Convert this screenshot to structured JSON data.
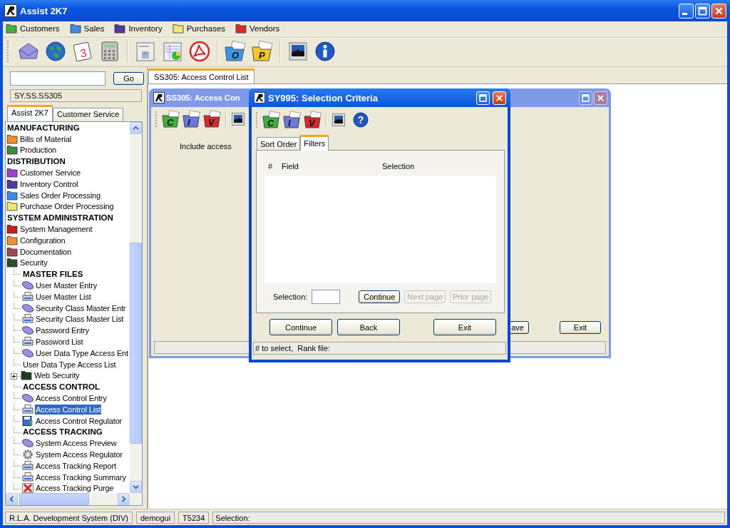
{
  "window": {
    "title": "Assist 2K7"
  },
  "menu": [
    {
      "label": "Customers",
      "color": "#3cb43c"
    },
    {
      "label": "Sales",
      "color": "#3c8ce6"
    },
    {
      "label": "Inventory",
      "color": "#4b3ca0"
    },
    {
      "label": "Purchases",
      "color": "#f0e678"
    },
    {
      "label": "Vendors",
      "color": "#dc2828"
    }
  ],
  "toolbar": {
    "calendar_day": "3",
    "folders": [
      {
        "letter": "O",
        "color": "#3c96e6"
      },
      {
        "letter": "P",
        "color": "#f0c828"
      }
    ]
  },
  "navigator": {
    "search": {
      "button": "Go"
    },
    "path": "SY.SS.SS305",
    "tabs": [
      {
        "label": "Assist 2K7",
        "selected": true
      },
      {
        "label": "Customer Service",
        "selected": false
      }
    ],
    "tree": [
      {
        "label": "MANUFACTURING",
        "kind": "header",
        "selected": false
      },
      {
        "label": "Bills of Material",
        "kind": "folder",
        "color": "#f0902c",
        "selected": false
      },
      {
        "label": "Production",
        "kind": "folder",
        "color": "#3c8c3c",
        "selected": false
      },
      {
        "label": "DISTRIBUTION",
        "kind": "header",
        "selected": false
      },
      {
        "label": "Customer Service",
        "kind": "folder",
        "color": "#a040c8",
        "selected": false
      },
      {
        "label": "Inventory Control",
        "kind": "folder",
        "color": "#4b3ca0",
        "selected": false
      },
      {
        "label": "Sales Order Processing",
        "kind": "folder",
        "color": "#3c8ce6",
        "selected": false
      },
      {
        "label": "Purchase Order Processing",
        "kind": "folder",
        "color": "#f0e678",
        "selected": false
      },
      {
        "label": "SYSTEM ADMINISTRATION",
        "kind": "header",
        "selected": false
      },
      {
        "label": "System Management",
        "kind": "folder",
        "color": "#c81e1e",
        "selected": false
      },
      {
        "label": "Configuration",
        "kind": "folder",
        "color": "#f0902c",
        "selected": false
      },
      {
        "label": "Documentation",
        "kind": "folder",
        "color": "#a04650",
        "selected": false
      },
      {
        "label": "Security",
        "kind": "folder",
        "color": "#285028",
        "selected": false,
        "children": [
          {
            "label": "MASTER FILES",
            "kind": "subheader",
            "selected": false
          },
          {
            "label": "User Master Entry",
            "kind": "oval",
            "selected": false
          },
          {
            "label": "User Master List",
            "kind": "printer",
            "selected": false
          },
          {
            "label": "Security Class Master Entr",
            "kind": "oval",
            "selected": false
          },
          {
            "label": "Security Class Master List",
            "kind": "printer",
            "selected": false
          },
          {
            "label": "Password Entry",
            "kind": "oval",
            "selected": false
          },
          {
            "label": "Password List",
            "kind": "printer",
            "selected": false
          },
          {
            "label": "User Data Type Access Ent",
            "kind": "oval",
            "selected": false
          },
          {
            "label": "User Data Type Access List",
            "kind": "plain",
            "selected": false
          },
          {
            "label": "Web Security",
            "kind": "folder",
            "color": "#1e3c1e",
            "selected": false,
            "expanded": false
          },
          {
            "label": "ACCESS CONTROL",
            "kind": "subheader",
            "selected": false
          },
          {
            "label": "Access Control Entry",
            "kind": "oval",
            "selected": false
          },
          {
            "label": "Access Control List",
            "kind": "printer",
            "selected": true
          },
          {
            "label": "Access Control Regulator",
            "kind": "disk",
            "selected": false
          },
          {
            "label": "ACCESS TRACKING",
            "kind": "subheader",
            "selected": false
          },
          {
            "label": "System Access Preview",
            "kind": "oval",
            "selected": false
          },
          {
            "label": "System Access Regulator",
            "kind": "gear",
            "selected": false
          },
          {
            "label": "Access Tracking Report",
            "kind": "printer",
            "selected": false
          },
          {
            "label": "Access Tracking Summary",
            "kind": "printer",
            "selected": false
          },
          {
            "label": "Access Tracking Purge",
            "kind": "cross",
            "selected": false
          }
        ]
      }
    ]
  },
  "document_tabs": [
    {
      "label": "SS305: Access Control List",
      "selected": true
    }
  ],
  "background_window": {
    "title": "SS305: Access Con",
    "tools": [
      {
        "letter": "C",
        "color": "#3cb43c"
      },
      {
        "letter": "I",
        "color": "#6c78e0"
      },
      {
        "letter": "V",
        "color": "#dc2828"
      }
    ],
    "prompt": "Include access",
    "buttons": [
      "ave",
      "Exit"
    ]
  },
  "dialog": {
    "title": "SY995: Selection Criteria",
    "tools": [
      {
        "letter": "C",
        "color": "#3cb43c"
      },
      {
        "letter": "I",
        "color": "#6c78e0"
      },
      {
        "letter": "V",
        "color": "#dc2828"
      }
    ],
    "help": "?",
    "tabs": [
      {
        "label": "Sort Order",
        "selected": false
      },
      {
        "label": "Filters",
        "selected": true
      }
    ],
    "columns": [
      "#",
      "Field",
      "Selection"
    ],
    "selection_label": "Selection:",
    "page_buttons": [
      {
        "label": "Continue",
        "disabled": false
      },
      {
        "label": "Next page",
        "disabled": true
      },
      {
        "label": "Prior page",
        "disabled": true
      }
    ],
    "buttons": [
      "Continue",
      "Back",
      "Exit"
    ],
    "status": "# to select,  Rank file:"
  },
  "status_bar": [
    "R.L.A. Development System (DIV)",
    "demogui",
    "T5234",
    "Selection:"
  ]
}
